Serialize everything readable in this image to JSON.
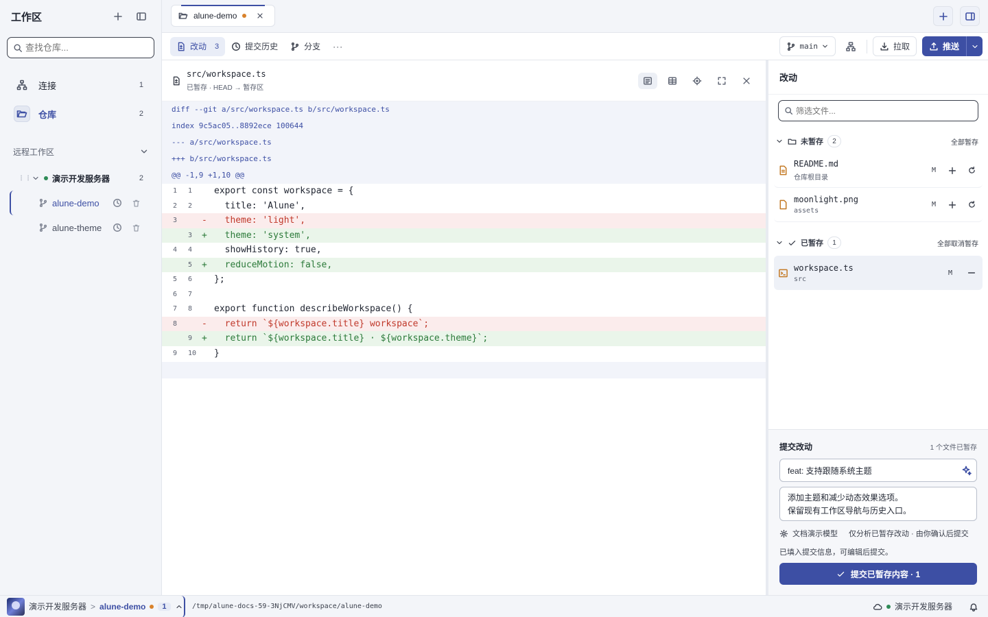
{
  "sidebar": {
    "title": "工作区",
    "search_placeholder": "查找仓库...",
    "nav": [
      {
        "label": "连接",
        "count": "1",
        "icon": "network-icon"
      },
      {
        "label": "仓库",
        "count": "2",
        "icon": "folder-open-icon"
      }
    ],
    "remote_title": "远程工作区",
    "server": {
      "name": "演示开发服务器",
      "count": "2",
      "status_color": "#2e8b57"
    },
    "repos": [
      {
        "name": "alune-demo",
        "active": true
      },
      {
        "name": "alune-theme",
        "active": false
      }
    ]
  },
  "tab": {
    "label": "alune-demo",
    "modified_color": "#d9822b"
  },
  "toolbar": {
    "changes_label": "改动",
    "changes_count": "3",
    "history_label": "提交历史",
    "branches_label": "分支",
    "more_label": "···",
    "branch": "main",
    "pull_label": "拉取",
    "push_label": "推送"
  },
  "diff": {
    "path": "src/workspace.ts",
    "subtitle": "已暂存 · HEAD → 暂存区",
    "meta": [
      "diff --git a/src/workspace.ts b/src/workspace.ts",
      "index 9c5ac05..8892ece 100644",
      "--- a/src/workspace.ts",
      "+++ b/src/workspace.ts",
      "@@ -1,9 +1,10 @@"
    ],
    "lines": [
      {
        "old": "1",
        "new": "1",
        "type": "ctx",
        "sign": "",
        "text": "export const workspace = {"
      },
      {
        "old": "2",
        "new": "2",
        "type": "ctx",
        "sign": "",
        "text": "  title: 'Alune',"
      },
      {
        "old": "3",
        "new": "",
        "type": "del",
        "sign": "-",
        "text": "  theme: 'light',"
      },
      {
        "old": "",
        "new": "3",
        "type": "add",
        "sign": "+",
        "text": "  theme: 'system',"
      },
      {
        "old": "4",
        "new": "4",
        "type": "ctx",
        "sign": "",
        "text": "  showHistory: true,"
      },
      {
        "old": "",
        "new": "5",
        "type": "add",
        "sign": "+",
        "text": "  reduceMotion: false,"
      },
      {
        "old": "5",
        "new": "6",
        "type": "ctx",
        "sign": "",
        "text": "};"
      },
      {
        "old": "6",
        "new": "7",
        "type": "ctx",
        "sign": "",
        "text": ""
      },
      {
        "old": "7",
        "new": "8",
        "type": "ctx",
        "sign": "",
        "text": "export function describeWorkspace() {"
      },
      {
        "old": "8",
        "new": "",
        "type": "del",
        "sign": "-",
        "text": "  return `${workspace.title} workspace`;"
      },
      {
        "old": "",
        "new": "9",
        "type": "add",
        "sign": "+",
        "text": "  return `${workspace.title} · ${workspace.theme}`;"
      },
      {
        "old": "9",
        "new": "10",
        "type": "ctx",
        "sign": "",
        "text": "}"
      }
    ]
  },
  "changes": {
    "title": "改动",
    "filter_placeholder": "筛选文件...",
    "unstaged": {
      "label": "未暂存",
      "count": "2",
      "action": "全部暂存",
      "files": [
        {
          "name": "README.md",
          "dir": "仓库根目录",
          "status": "M"
        },
        {
          "name": "moonlight.png",
          "dir": "assets",
          "status": "M"
        }
      ]
    },
    "staged": {
      "label": "已暂存",
      "count": "1",
      "action": "全部取消暂存",
      "files": [
        {
          "name": "workspace.ts",
          "dir": "src",
          "status": "M"
        }
      ]
    }
  },
  "commit": {
    "title": "提交改动",
    "staged_note": "1 个文件已暂存",
    "summary": "feat: 支持跟随系统主题",
    "body_line1": "添加主题和减少动态效果选项。",
    "body_line2": "保留现有工作区导航与历史入口。",
    "model_label": "文档演示模型",
    "model_hint": "仅分析已暂存改动 · 由你确认后提交",
    "filled_note": "已填入提交信息，可编辑后提交。",
    "submit_label": "提交已暂存内容 · 1"
  },
  "status": {
    "server": "演示开发服务器",
    "sep": ">",
    "repo": "alune-demo",
    "count": "1",
    "path": "/tmp/alune-docs-59-3NjCMV/workspace/alune-demo",
    "remote": "演示开发服务器"
  },
  "colors": {
    "accent": "#3d4fa4",
    "added": "#2c7a3a",
    "removed": "#c0392b",
    "modified_dot": "#d9822b"
  }
}
